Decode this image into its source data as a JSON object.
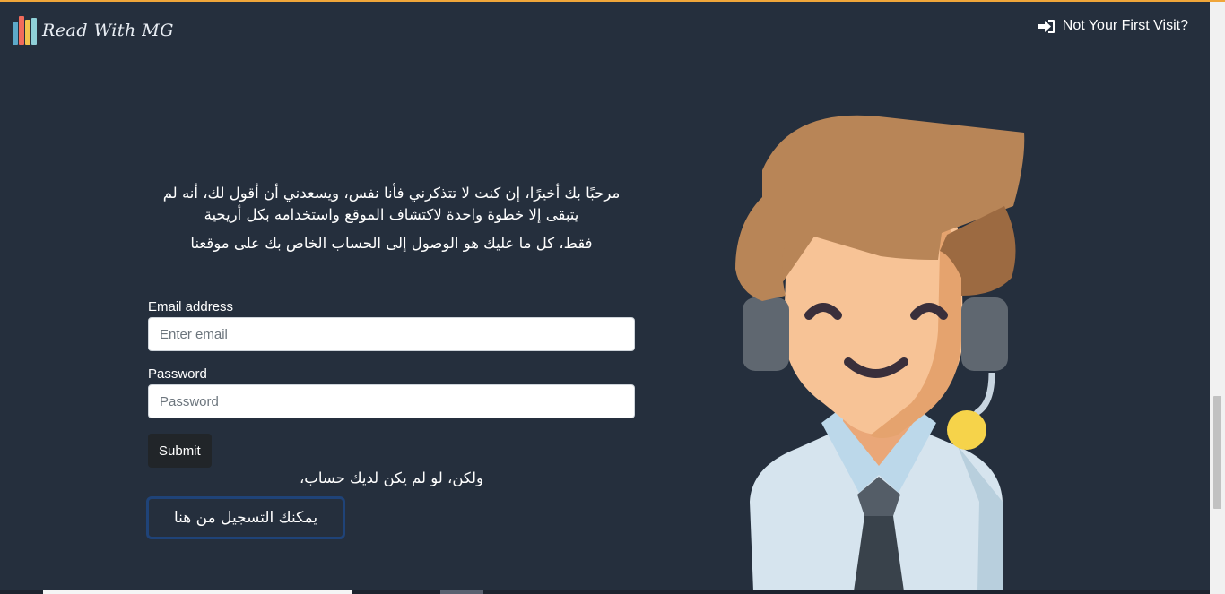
{
  "header": {
    "brand_name": "Read With MG",
    "nav_link": "Not Your First Visit?",
    "nav_icon": "sign-in-icon"
  },
  "intro": {
    "line1": "مرحبًا بك أخيرًا، إن كنت لا تتذكرني فأنا نفس، ويسعدني أن أقول لك، أنه لم يتبقى إلا خطوة واحدة لاكتشاف الموقع واستخدامه بكل أريحية",
    "line2": "فقط، كل ما عليك هو الوصول إلى الحساب الخاص بك على موقعنا"
  },
  "form": {
    "email_label": "Email address",
    "email_placeholder": "Enter email",
    "email_value": "",
    "password_label": "Password",
    "password_placeholder": "Password",
    "password_value": "",
    "submit_label": "Submit"
  },
  "register": {
    "prompt": "ولكن، لو لم يكن لديك حساب،",
    "button_label": "يمكنك التسجيل من هنا"
  },
  "colors": {
    "background": "#252f3d",
    "accent_border": "#f0a63a",
    "button_dark": "#212529",
    "register_border": "#1f4378"
  }
}
